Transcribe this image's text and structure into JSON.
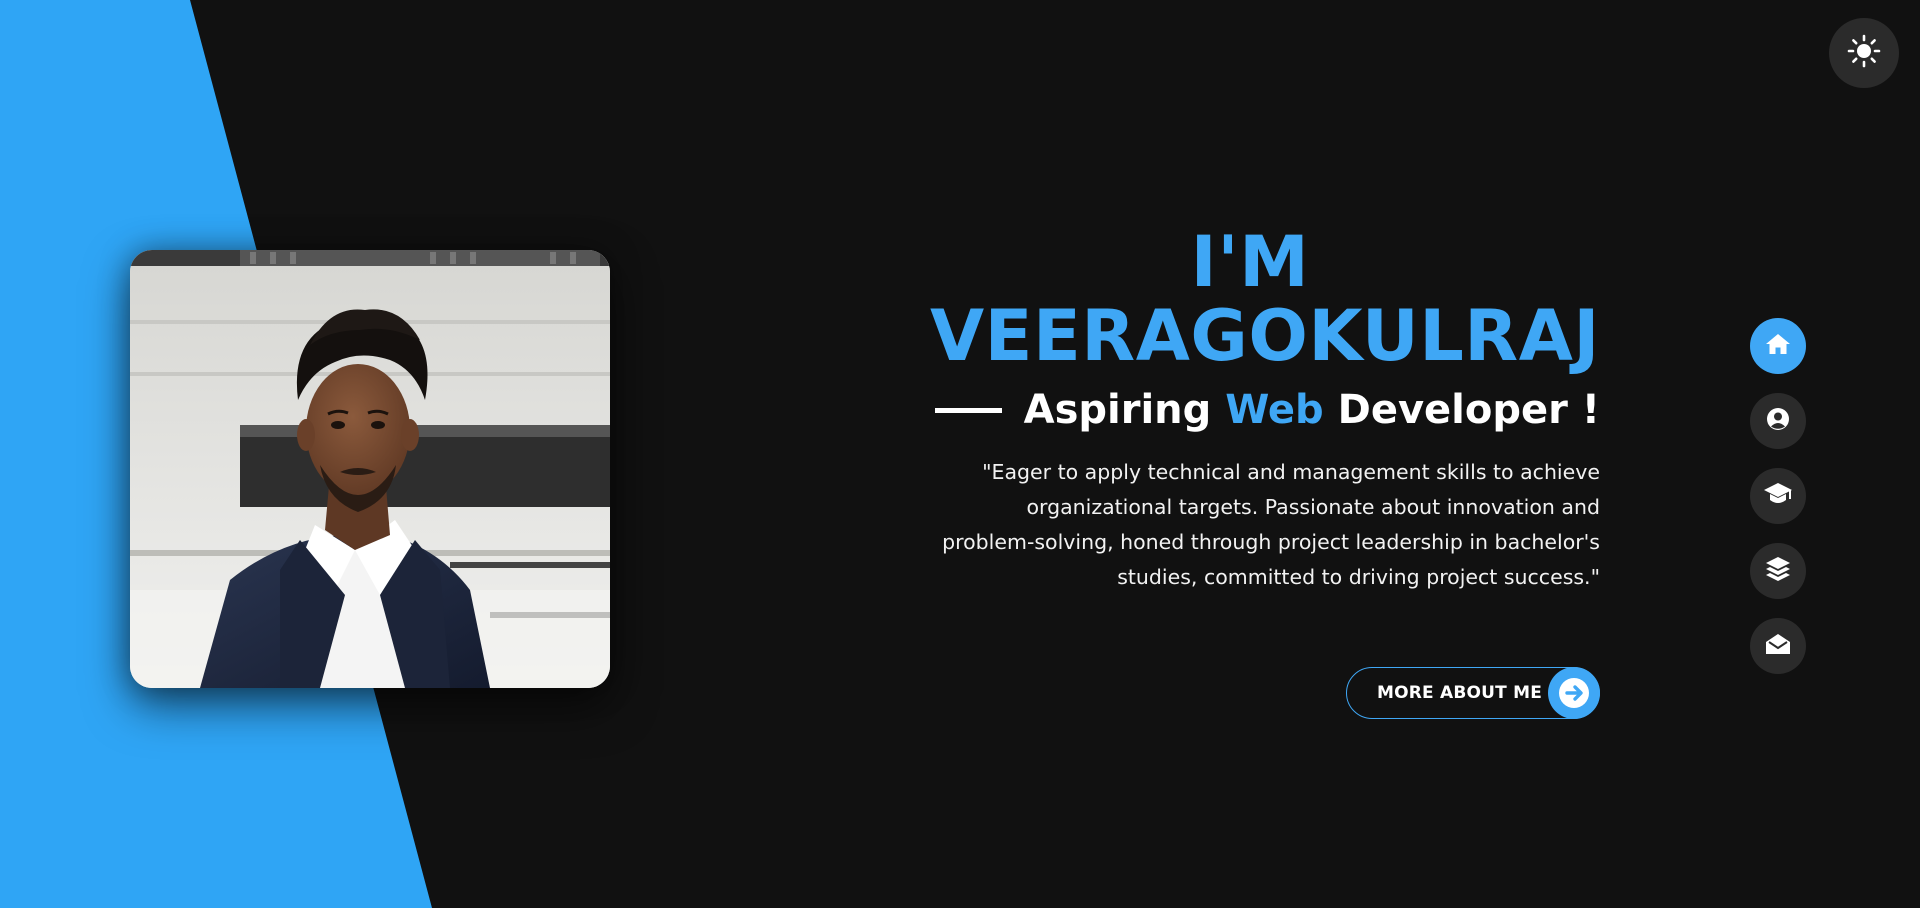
{
  "hero": {
    "greeting_line1": "I'M",
    "greeting_line2": "VEERAGOKULRAJ",
    "subtitle_part1": "Aspiring ",
    "subtitle_highlight": "Web",
    "subtitle_part2": " Developer !",
    "description": "\"Eager to apply technical and management skills to achieve organizational targets. Passionate about innovation and problem-solving, honed through project leadership in bachelor's studies, committed to driving project success.\""
  },
  "cta": {
    "label": "MORE ABOUT ME",
    "icon": "arrow-right-circle-icon"
  },
  "theme_toggle": {
    "icon": "sun-icon"
  },
  "side_nav": {
    "items": [
      {
        "id": "home",
        "icon": "home-icon",
        "active": true
      },
      {
        "id": "about",
        "icon": "user-icon",
        "active": false
      },
      {
        "id": "education",
        "icon": "graduation-cap-icon",
        "active": false
      },
      {
        "id": "portfolio",
        "icon": "layers-icon",
        "active": false
      },
      {
        "id": "contact",
        "icon": "envelope-open-icon",
        "active": false
      }
    ]
  },
  "colors": {
    "background": "#111111",
    "accent": "#3fa7f5",
    "accent_shape": "#2fa5f5",
    "nav_item_bg": "#2b2b2b",
    "text": "#ffffff"
  }
}
